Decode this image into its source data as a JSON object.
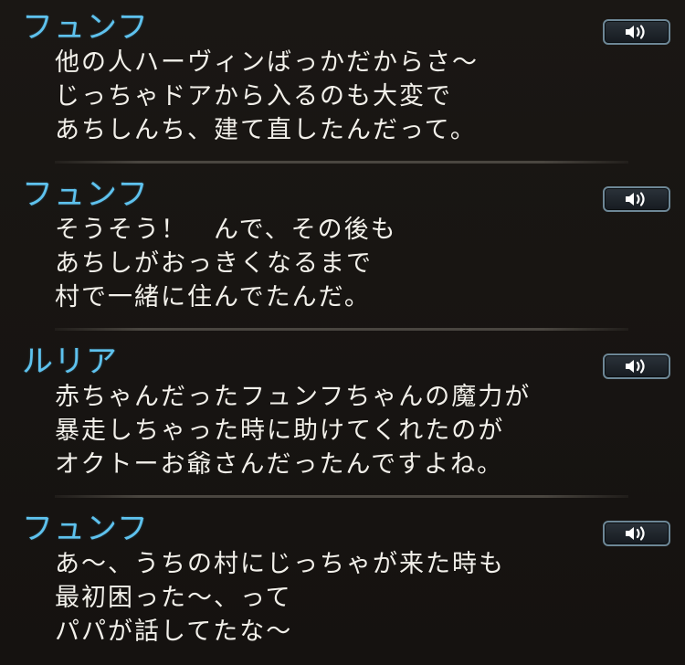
{
  "entries": [
    {
      "speaker": "フュンフ",
      "lines": [
        "他の人ハーヴィンばっかだからさ～",
        "じっちゃドアから入るのも大変で",
        "あちしんち、建て直したんだって。"
      ],
      "voice_icon": "speaker-volume-icon"
    },
    {
      "speaker": "フュンフ",
      "lines": [
        "そうそう！　んで、その後も",
        "あちしがおっきくなるまで",
        "村で一緒に住んでたんだ。"
      ],
      "voice_icon": "speaker-volume-icon"
    },
    {
      "speaker": "ルリア",
      "lines": [
        "赤ちゃんだったフュンフちゃんの魔力が",
        "暴走しちゃった時に助けてくれたのが",
        "オクトーお爺さんだったんですよね。"
      ],
      "voice_icon": "speaker-volume-icon"
    },
    {
      "speaker": "フュンフ",
      "lines": [
        "あ～、うちの村にじっちゃが来た時も",
        "最初困った～、って",
        "パパが話してたな～"
      ],
      "voice_icon": "speaker-volume-icon"
    }
  ],
  "colors": {
    "speaker": "#5ec2ee",
    "text": "#f2f0ea",
    "background": "#171411",
    "button_border": "#6d8796"
  }
}
